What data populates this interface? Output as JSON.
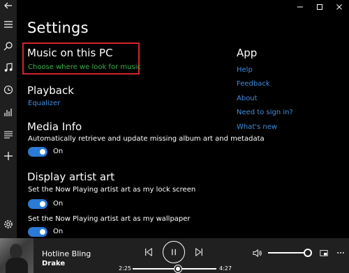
{
  "page": {
    "title": "Settings"
  },
  "music_pc": {
    "title": "Music on this PC",
    "link": "Choose where we look for music"
  },
  "playback": {
    "title": "Playback",
    "link": "Equalizer"
  },
  "media_info": {
    "title": "Media Info",
    "description": "Automatically retrieve and update missing album art and metadata",
    "toggle_state": "On"
  },
  "artist_art": {
    "title": "Display artist art",
    "lock_desc": "Set the Now Playing artist art as my lock screen",
    "lock_state": "On",
    "wall_desc": "Set the Now Playing artist art as my wallpaper",
    "wall_state": "On"
  },
  "app": {
    "title": "App",
    "links": [
      "Help",
      "Feedback",
      "About",
      "Need to sign in?",
      "What's new"
    ]
  },
  "player": {
    "track": "Hotline Bling",
    "artist": "Drake",
    "elapsed": "2:25",
    "duration": "4:27",
    "progress": 0.54,
    "volume": 1.0
  },
  "nav_icons": [
    "back-arrow-icon",
    "hamburger-menu-icon",
    "search-icon",
    "music-note-icon",
    "recent-clock-icon",
    "now-playing-bars-icon",
    "playlists-icon",
    "add-icon",
    "settings-gear-icon"
  ],
  "colors": {
    "accent": "#3f8fe0",
    "green": "#38b24a",
    "highlight": "#d5232b"
  }
}
